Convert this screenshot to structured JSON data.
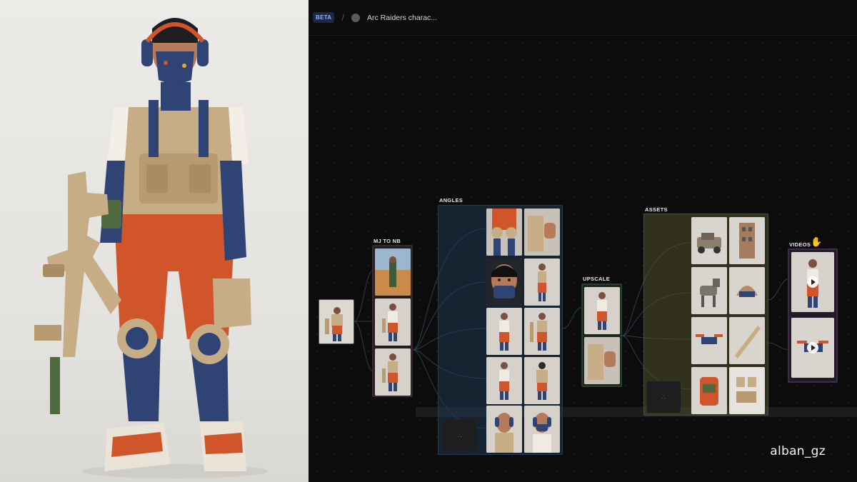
{
  "header": {
    "badge": "BETA",
    "separator": "/",
    "project_title": "Arc Raiders charac..."
  },
  "groups": {
    "mj_to_nb": "MJ TO NB",
    "angles": "ANGLES",
    "upscale": "UPSCALE",
    "assets": "ASSETS",
    "videos": "VIDEOS"
  },
  "icons": {
    "hand": "hand-pointer-icon",
    "play": "play-icon",
    "node_placeholder": "empty-node-icon"
  },
  "colors": {
    "angles_group": "#1f3852",
    "assets_group": "#4e4e2a",
    "mj_to_nb_frame": "#3a2a30",
    "upscale_frame": "#27402c",
    "videos_frame": "#3d2b49",
    "accent_orange": "#d0552a",
    "accent_navy": "#2f4374",
    "gear_tan": "#c7ad86"
  },
  "watermark": "alban_gz"
}
